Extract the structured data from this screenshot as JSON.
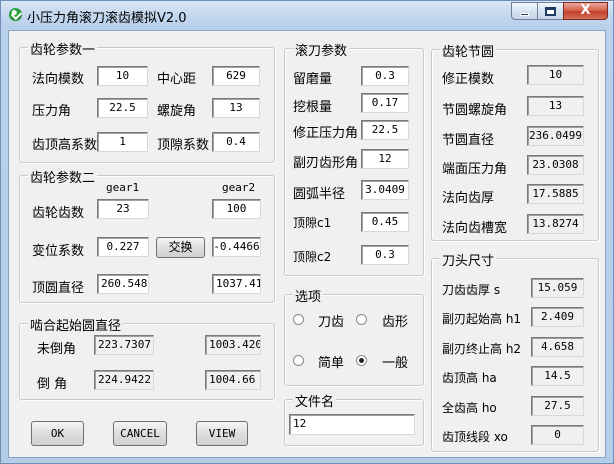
{
  "window": {
    "title": "小压力角滚刀滚齿模拟V2.0",
    "icon": "app-check-icon",
    "buttons": {
      "minimize": "_",
      "maximize": "□",
      "close": "X"
    }
  },
  "gear_params1": {
    "legend": "齿轮参数一",
    "normal_module_label": "法向模数",
    "normal_module": "10",
    "center_distance_label": "中心距",
    "center_distance": "629",
    "pressure_angle_label": "压力角",
    "pressure_angle": "22.5",
    "helix_angle_label": "螺旋角",
    "helix_angle": "13",
    "addendum_coef_label": "齿顶高系数",
    "addendum_coef": "1",
    "clearance_coef_label": "顶隙系数",
    "clearance_coef": "0.4"
  },
  "gear_params2": {
    "legend": "齿轮参数二",
    "gear1_header": "gear1",
    "gear2_header": "gear2",
    "teeth_label": "齿轮齿数",
    "teeth1": "23",
    "teeth2": "100",
    "shift_label": "变位系数",
    "shift1": "0.227",
    "swap_button": "交换",
    "shift2": "-0.4466",
    "tip_dia_label": "顶圆直径",
    "tip_dia1": "260.548",
    "tip_dia2": "1037.410"
  },
  "mesh_start": {
    "legend": "啮合起始圆直径",
    "no_chamfer_label": "未倒角",
    "no_chamfer1": "223.7307",
    "no_chamfer2": "1003.4201",
    "chamfer_label": "倒  角",
    "chamfer1": "224.9422",
    "chamfer2": "1004.66"
  },
  "hob_params": {
    "legend": "滚刀参数",
    "grind_allow_label": "留磨量",
    "grind_allow": "0.3",
    "undercut_label": "挖根量",
    "undercut": "0.17",
    "mod_pressure_label": "修正压力角",
    "mod_pressure": "22.5",
    "sec_angle_label": "副刃齿形角",
    "sec_angle": "12",
    "arc_radius_label": "圆弧半径",
    "arc_radius": "3.0409",
    "clearance_c1_label": "顶隙c1",
    "clearance_c1": "0.45",
    "clearance_c2_label": "顶隙c2",
    "clearance_c2": "0.3"
  },
  "options": {
    "legend": "选项",
    "tooth_tip": "刀齿",
    "tooth_profile": "齿形",
    "simple": "简单",
    "general": "一般"
  },
  "file": {
    "legend": "文件名",
    "value": "12"
  },
  "pitch": {
    "legend": "齿轮节圆",
    "mod_module_label": "修正模数",
    "mod_module": "10",
    "pitch_helix_label": "节圆螺旋角",
    "pitch_helix": "13",
    "pitch_dia_label": "节圆直径",
    "pitch_dia": "236.0499",
    "transverse_pa_label": "端面压力角",
    "transverse_pa": "23.0308",
    "normal_thick_label": "法向齿厚",
    "normal_thick": "17.5885",
    "normal_space_label": "法向齿槽宽",
    "normal_space": "13.8274"
  },
  "cutter": {
    "legend": "刀头尺寸",
    "tooth_thick_label": "刀齿齿厚 s",
    "tooth_thick": "15.059",
    "sec_start_label": "副刃起始高 h1",
    "sec_start": "2.409",
    "sec_end_label": "副刃终止高 h2",
    "sec_end": "4.658",
    "addendum_label": "齿顶高 ha",
    "addendum": "14.5",
    "total_height_label": "全齿高 ho",
    "total_height": "27.5",
    "tip_line_label": "齿顶线段 xo",
    "tip_line": "0"
  },
  "actions": {
    "ok": "OK",
    "cancel": "CANCEL",
    "view": "VIEW"
  }
}
